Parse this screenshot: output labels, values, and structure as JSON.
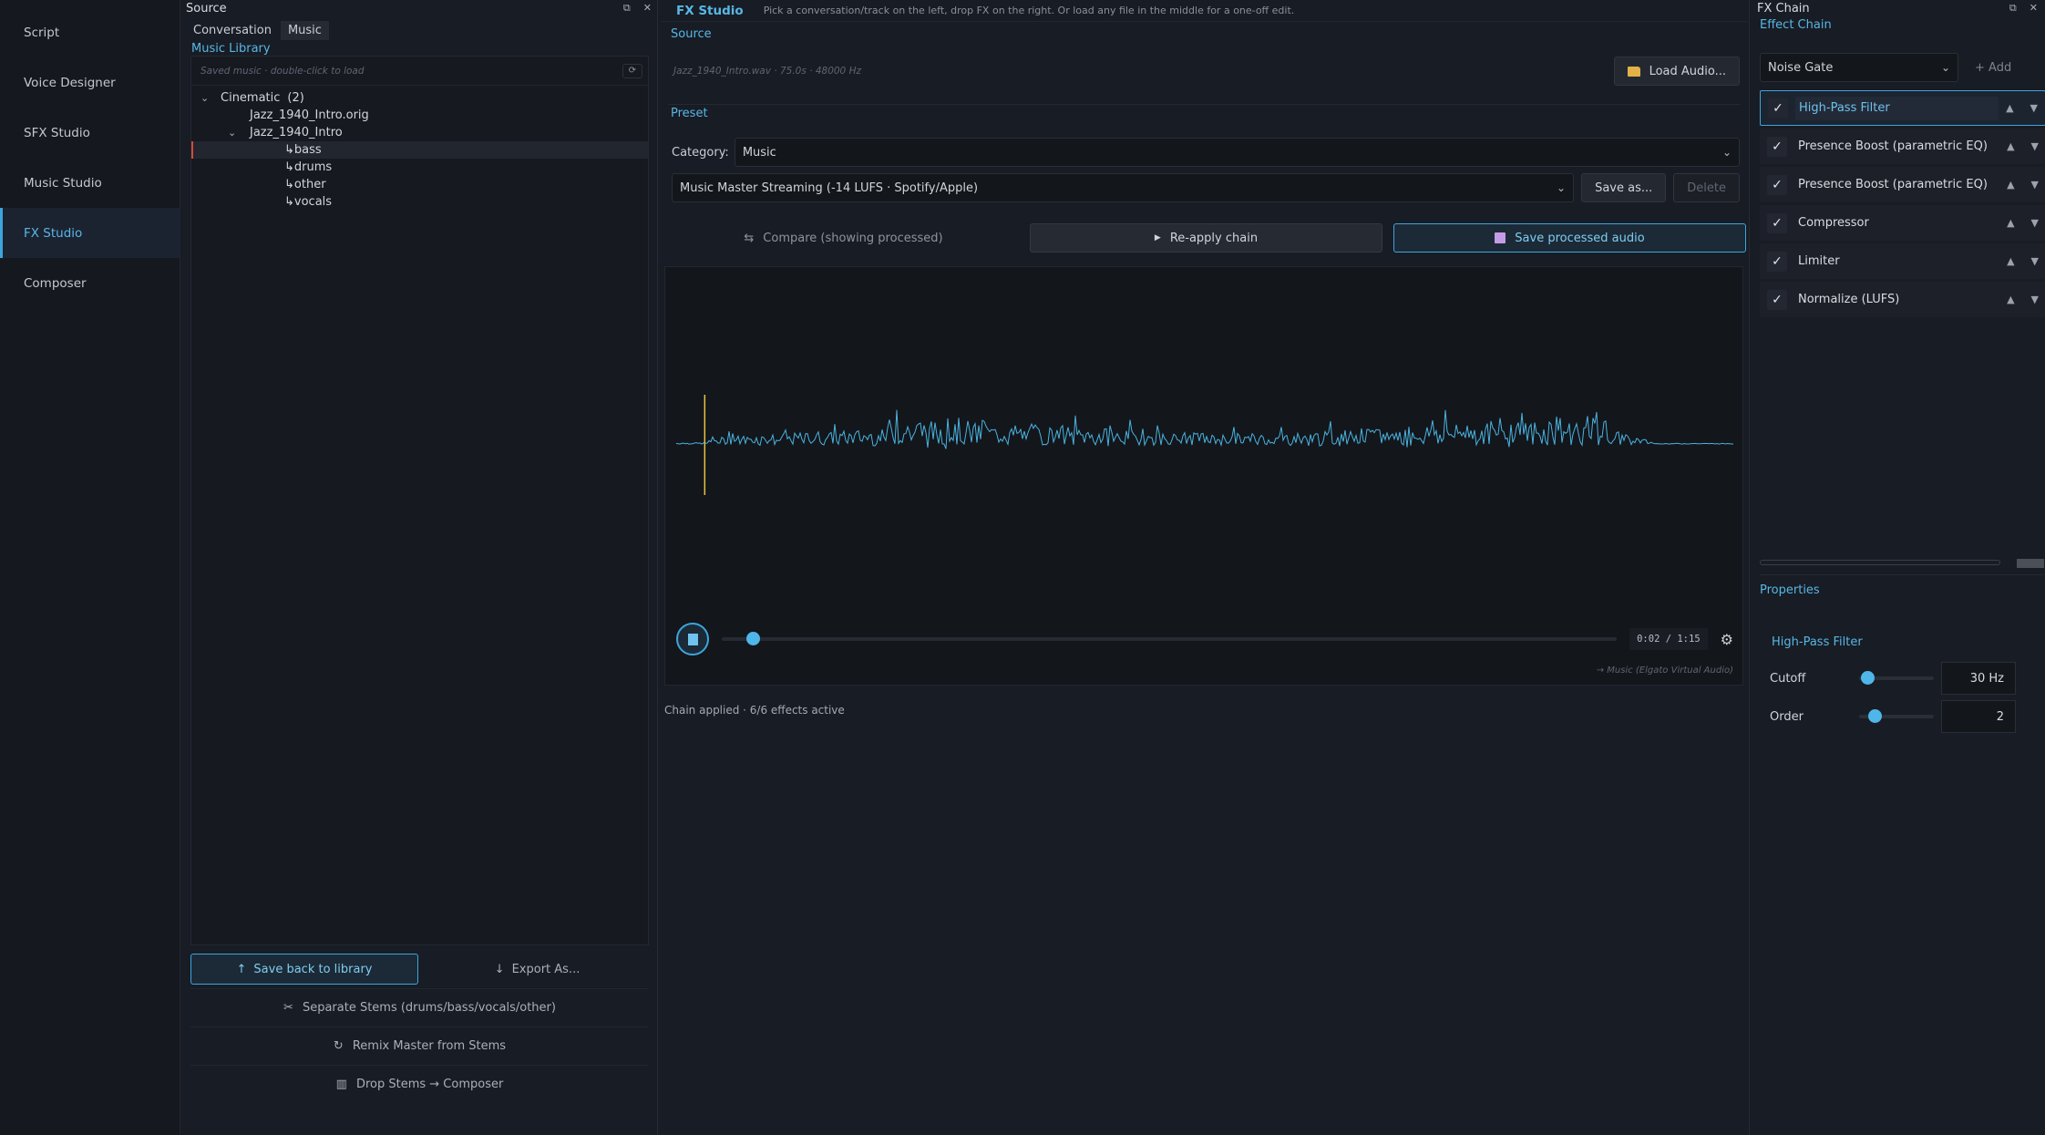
{
  "nav": {
    "items": [
      {
        "label": "Script",
        "active": false
      },
      {
        "label": "Voice Designer",
        "active": false
      },
      {
        "label": "SFX Studio",
        "active": false
      },
      {
        "label": "Music Studio",
        "active": false
      },
      {
        "label": "FX Studio",
        "active": true
      },
      {
        "label": "Composer",
        "active": false
      }
    ]
  },
  "source_panel": {
    "title": "Source",
    "tabs": [
      {
        "label": "Conversation",
        "active": false
      },
      {
        "label": "Music",
        "active": true
      }
    ],
    "library_title": "Music Library",
    "library_hint": "Saved music · double-click to load",
    "tree": {
      "group_label": "Cinematic",
      "group_count": "(2)",
      "item_orig": "Jazz_1940_Intro.orig",
      "item_main": "Jazz_1940_Intro",
      "stems": [
        "bass",
        "drums",
        "other",
        "vocals"
      ],
      "selected_stem": "bass"
    },
    "save_back_label": "Save back to library",
    "export_label": "Export As...",
    "separate_label": "Separate Stems (drums/bass/vocals/other)",
    "remix_label": "Remix Master from Stems",
    "drop_label": "Drop Stems → Composer"
  },
  "center": {
    "title": "FX Studio",
    "hint": "Pick a conversation/track on the left, drop FX on the right. Or load any file in the middle for a one-off edit.",
    "source_label": "Source",
    "source_meta": "Jazz_1940_Intro.wav · 75.0s · 48000 Hz",
    "load_label": "Load Audio...",
    "preset_label": "Preset",
    "category_label": "Category:",
    "category_value": "Music",
    "preset_value": "Music Master Streaming (-14 LUFS · Spotify/Apple)",
    "save_as_label": "Save as...",
    "delete_label": "Delete",
    "compare_label": "Compare (showing processed)",
    "reapply_label": "Re-apply chain",
    "save_processed_label": "Save processed audio",
    "time": "0:02 / 1:15",
    "playback_fraction": 0.027,
    "device": "→ Music (Elgato Virtual Audio)",
    "status": "Chain applied · 6/6 effects active",
    "colors": {
      "accent": "#3da5dd",
      "wave": "#4ab3e0",
      "playhead": "#e8c440"
    }
  },
  "fx_chain": {
    "title": "FX Chain",
    "section_label": "Effect Chain",
    "add_select_value": "Noise Gate",
    "add_label": "+ Add",
    "items": [
      {
        "name": "High-Pass Filter",
        "enabled": true,
        "active": true
      },
      {
        "name": "Presence Boost (parametric EQ)",
        "enabled": true,
        "active": false
      },
      {
        "name": "Presence Boost (parametric EQ)",
        "enabled": true,
        "active": false
      },
      {
        "name": "Compressor",
        "enabled": true,
        "active": false
      },
      {
        "name": "Limiter",
        "enabled": true,
        "active": false
      },
      {
        "name": "Normalize (LUFS)",
        "enabled": true,
        "active": false
      }
    ],
    "properties_label": "Properties",
    "selected_effect": "High-Pass Filter",
    "params": [
      {
        "name": "Cutoff",
        "value": "30 Hz",
        "slider": 0.03
      },
      {
        "name": "Order",
        "value": "2",
        "slider": 0.12
      }
    ]
  }
}
